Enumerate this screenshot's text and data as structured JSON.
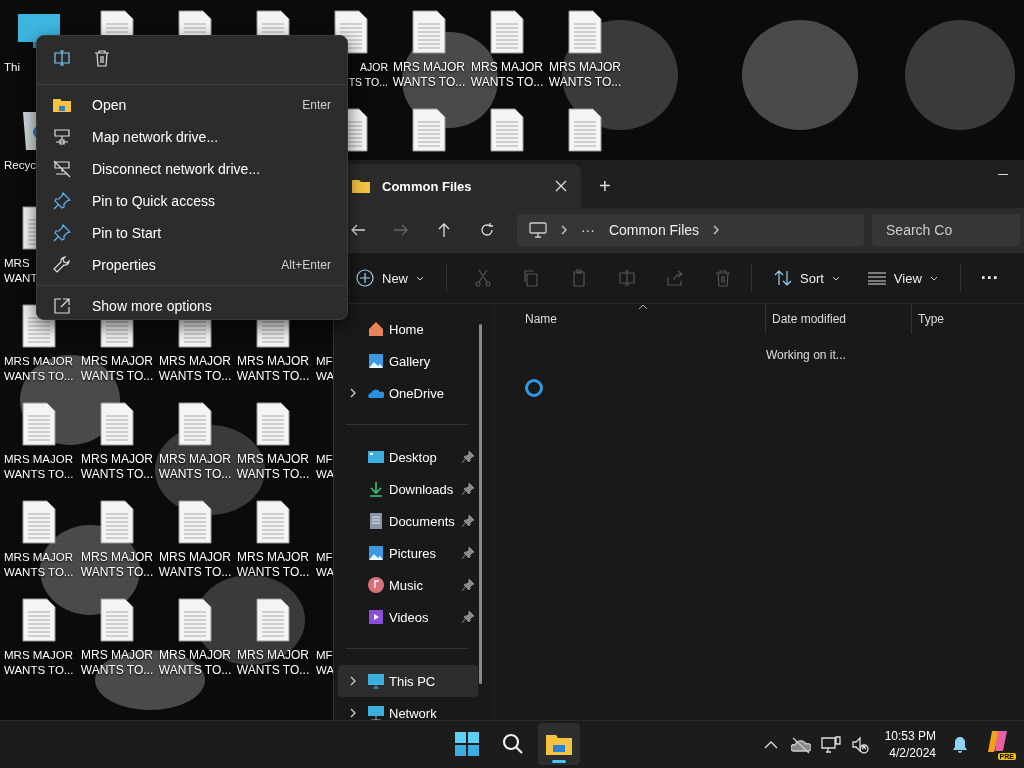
{
  "desktop": {
    "rows": [
      [
        {
          "kind": "pc",
          "lines": [
            "Thi"
          ]
        },
        {
          "kind": "file"
        },
        {
          "kind": "file"
        },
        {
          "kind": "file"
        },
        {
          "kind": "file",
          "lines": [
            "AJOR",
            "TS TO..."
          ]
        },
        {
          "kind": "file",
          "lines": [
            "MRS MAJOR",
            "WANTS TO..."
          ]
        },
        {
          "kind": "file",
          "lines": [
            "MRS MAJOR",
            "WANTS TO..."
          ]
        },
        {
          "kind": "file",
          "lines": [
            "MRS MAJOR",
            "WANTS TO..."
          ]
        }
      ],
      [
        {
          "kind": "bin",
          "lines": [
            "Recyc"
          ]
        },
        null,
        null,
        null,
        {
          "kind": "file"
        },
        {
          "kind": "file"
        },
        {
          "kind": "file"
        },
        {
          "kind": "file"
        }
      ],
      [
        {
          "kind": "file",
          "lines": [
            "MRS",
            "WANT"
          ]
        }
      ],
      [
        {
          "kind": "file",
          "lines": [
            "MRS MAJOR",
            "WANTS TO..."
          ]
        },
        {
          "kind": "file",
          "lines": [
            "MRS MAJOR",
            "WANTS TO..."
          ]
        },
        {
          "kind": "file",
          "lines": [
            "MRS MAJOR",
            "WANTS TO..."
          ]
        },
        {
          "kind": "file",
          "lines": [
            "MRS MAJOR",
            "WANTS TO..."
          ]
        },
        {
          "kind": "label",
          "lines": [
            "MF",
            "WA"
          ]
        }
      ],
      [
        {
          "kind": "file",
          "lines": [
            "MRS MAJOR",
            "WANTS TO..."
          ]
        },
        {
          "kind": "file",
          "lines": [
            "MRS MAJOR",
            "WANTS TO..."
          ]
        },
        {
          "kind": "file",
          "lines": [
            "MRS MAJOR",
            "WANTS TO..."
          ]
        },
        {
          "kind": "file",
          "lines": [
            "MRS MAJOR",
            "WANTS TO..."
          ]
        },
        {
          "kind": "label",
          "lines": [
            "MF",
            "WA"
          ]
        }
      ],
      [
        {
          "kind": "file",
          "lines": [
            "MRS MAJOR",
            "WANTS TO..."
          ]
        },
        {
          "kind": "file",
          "lines": [
            "MRS MAJOR",
            "WANTS TO..."
          ]
        },
        {
          "kind": "file",
          "lines": [
            "MRS MAJOR",
            "WANTS TO..."
          ]
        },
        {
          "kind": "file",
          "lines": [
            "MRS MAJOR",
            "WANTS TO..."
          ]
        },
        {
          "kind": "label",
          "lines": [
            "MF",
            "WA"
          ]
        }
      ],
      [
        {
          "kind": "file",
          "lines": [
            "MRS MAJOR",
            "WANTS TO..."
          ]
        },
        {
          "kind": "file",
          "lines": [
            "MRS MAJOR",
            "WANTS TO..."
          ]
        },
        {
          "kind": "file",
          "lines": [
            "MRS MAJOR",
            "WANTS TO..."
          ]
        },
        {
          "kind": "file",
          "lines": [
            "MRS MAJOR",
            "WANTS TO..."
          ]
        },
        {
          "kind": "label",
          "lines": [
            "MF",
            "WA"
          ]
        }
      ]
    ]
  },
  "context_menu": {
    "actions": [
      {
        "kind": "rename"
      },
      {
        "kind": "delete"
      }
    ],
    "items": [
      {
        "kind": "open",
        "label": "Open",
        "shortcut": "Enter"
      },
      {
        "kind": "map",
        "label": "Map network drive..."
      },
      {
        "kind": "disconnect",
        "label": "Disconnect network drive..."
      },
      {
        "kind": "pin",
        "label": "Pin to Quick access"
      },
      {
        "kind": "pin",
        "label": "Pin to Start"
      },
      {
        "kind": "properties",
        "label": "Properties",
        "shortcut": "Alt+Enter"
      }
    ],
    "footer": {
      "kind": "more",
      "label": "Show more options"
    }
  },
  "explorer": {
    "tabs": [
      {
        "title": "Common Files",
        "selected": true
      }
    ],
    "new_tab": "+",
    "nav": [
      {
        "kind": "back",
        "disabled": false
      },
      {
        "kind": "forward",
        "disabled": true
      },
      {
        "kind": "up",
        "disabled": false
      },
      {
        "kind": "refresh",
        "disabled": false
      }
    ],
    "breadcrumb": {
      "overflow": "···",
      "current": "Common Files"
    },
    "search": {
      "placeholder": "Search Co"
    },
    "toolbar": {
      "new": "New",
      "actions": [
        {
          "kind": "cut",
          "disabled": true
        },
        {
          "kind": "copy",
          "disabled": true
        },
        {
          "kind": "paste",
          "disabled": true
        },
        {
          "kind": "rename",
          "disabled": true
        },
        {
          "kind": "share",
          "disabled": true
        },
        {
          "kind": "delete",
          "disabled": true
        }
      ],
      "sort": "Sort",
      "view": "View",
      "more": "···"
    },
    "sidebar": {
      "groups": [
        [
          {
            "kind": "home",
            "label": "Home",
            "expandable": false,
            "pinned": false,
            "selected": false
          },
          {
            "kind": "gallery",
            "label": "Gallery",
            "expandable": false,
            "pinned": false,
            "selected": false
          },
          {
            "kind": "onedrive",
            "label": "OneDrive",
            "expandable": true,
            "pinned": false,
            "selected": false
          }
        ],
        [
          {
            "kind": "desktop",
            "label": "Desktop",
            "expandable": false,
            "pinned": true,
            "selected": false
          },
          {
            "kind": "downloads",
            "label": "Downloads",
            "expandable": false,
            "pinned": true,
            "selected": false
          },
          {
            "kind": "documents",
            "label": "Documents",
            "expandable": false,
            "pinned": true,
            "selected": false
          },
          {
            "kind": "pictures",
            "label": "Pictures",
            "expandable": false,
            "pinned": true,
            "selected": false
          },
          {
            "kind": "music",
            "label": "Music",
            "expandable": false,
            "pinned": true,
            "selected": false
          },
          {
            "kind": "videos",
            "label": "Videos",
            "expandable": false,
            "pinned": true,
            "selected": false
          }
        ],
        [
          {
            "kind": "pc",
            "label": "This PC",
            "expandable": true,
            "pinned": false,
            "selected": true
          },
          {
            "kind": "network",
            "label": "Network",
            "expandable": true,
            "pinned": false,
            "selected": false
          }
        ]
      ]
    },
    "columns": [
      {
        "label": "Name",
        "sorted": true
      },
      {
        "label": "Date modified",
        "sorted": false
      },
      {
        "label": "Type",
        "sorted": false
      }
    ],
    "status": "Working on it...",
    "loading": true
  },
  "taskbar": {
    "apps": [
      {
        "kind": "start",
        "active": false
      },
      {
        "kind": "search",
        "active": false
      },
      {
        "kind": "explorer",
        "active": true
      }
    ],
    "tray": [
      {
        "kind": "overflow"
      },
      {
        "kind": "onedrive"
      },
      {
        "kind": "network"
      },
      {
        "kind": "volume"
      }
    ],
    "time": "10:53 PM",
    "date": "4/2/2024",
    "badge": "PRE"
  }
}
